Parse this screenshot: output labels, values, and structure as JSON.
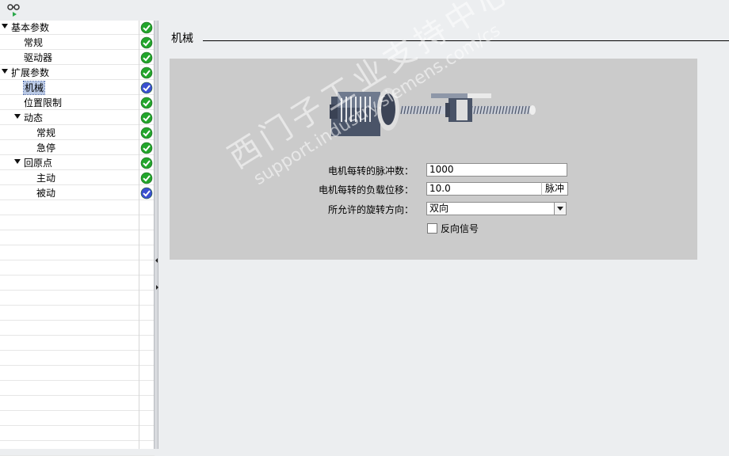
{
  "toolbar": {
    "icon": "glasses-play-icon"
  },
  "tree": {
    "items": [
      {
        "label": "基本参数",
        "level": 0,
        "expandable": true,
        "status": "ok"
      },
      {
        "label": "常规",
        "level": 1,
        "expandable": false,
        "status": "ok"
      },
      {
        "label": "驱动器",
        "level": 1,
        "expandable": false,
        "status": "ok"
      },
      {
        "label": "扩展参数",
        "level": 0,
        "expandable": true,
        "status": "ok"
      },
      {
        "label": "机械",
        "level": 1,
        "expandable": false,
        "status": "info",
        "selected": true
      },
      {
        "label": "位置限制",
        "level": 1,
        "expandable": false,
        "status": "ok"
      },
      {
        "label": "动态",
        "level": 1,
        "expandable": true,
        "status": "ok"
      },
      {
        "label": "常规",
        "level": 2,
        "expandable": false,
        "status": "ok"
      },
      {
        "label": "急停",
        "level": 2,
        "expandable": false,
        "status": "ok"
      },
      {
        "label": "回原点",
        "level": 1,
        "expandable": true,
        "status": "ok"
      },
      {
        "label": "主动",
        "level": 2,
        "expandable": false,
        "status": "ok"
      },
      {
        "label": "被动",
        "level": 2,
        "expandable": false,
        "status": "info"
      }
    ]
  },
  "section": {
    "title": "机械"
  },
  "form": {
    "pulses_label": "电机每转的脉冲数：",
    "pulses_value": "1000",
    "load_label": "电机每转的负载位移：",
    "load_value": "10.0",
    "load_unit": "脉冲",
    "direction_label": "所允许的旋转方向：",
    "direction_value": "双向",
    "invert_label": "反向信号",
    "invert_checked": false
  },
  "watermark": {
    "line1": "西门子工业支持中心",
    "line2": "support.industry.siemens.com/cs"
  },
  "colors": {
    "ok": "#22a52b",
    "info": "#3a4fd0",
    "panel": "#cbcbcb"
  }
}
